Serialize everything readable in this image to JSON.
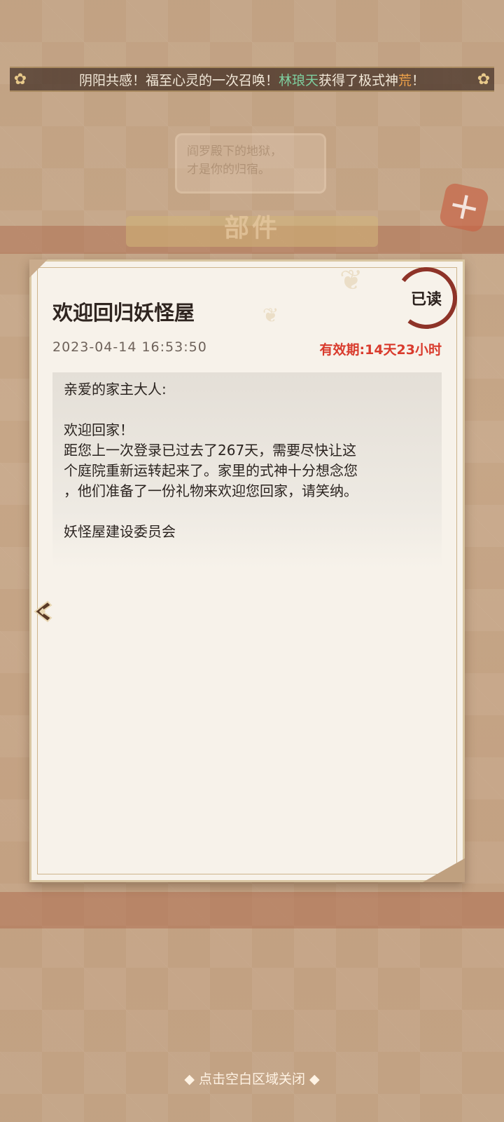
{
  "background": {
    "screen_title": "部件",
    "resources": [
      "",
      "",
      ""
    ],
    "bubble_lines": [
      "阎罗殿下的地狱，",
      "才是你的归宿。"
    ]
  },
  "marquee": {
    "prefix": "阴阳共感！福至心灵的一次召唤！",
    "player_name": "林琅天",
    "middle": "获得了极式神",
    "shikigami": "荒",
    "suffix": "！"
  },
  "mail": {
    "title": "欢迎回归妖怪屋",
    "read_badge": "已读",
    "date": "2023-04-14 16:53:50",
    "expiry": "有效期:14天23小时",
    "body": [
      "亲爱的家主大人:",
      "",
      "欢迎回家！",
      "距您上一次登录已过去了267天，需要尽快让这",
      "个庭院重新运转起来了。家里的式神十分想念您",
      "，他们准备了一份礼物来欢迎您回家，请笑纳。",
      "",
      "妖怪屋建设委员会"
    ]
  },
  "close_hint": "◆ 点击空白区域关闭 ◆",
  "colors": {
    "expiry_red": "#d93b2d",
    "name_green": "#7ecf9f",
    "shikigami_orange": "#f0a34a",
    "stamp_red": "#8e3328"
  }
}
